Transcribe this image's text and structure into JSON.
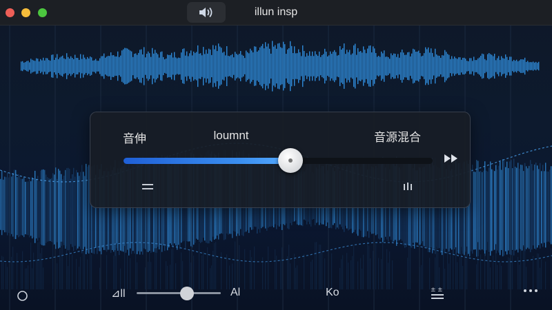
{
  "window": {
    "title": "illun insp"
  },
  "titlebar": {
    "speaker_icon": "speaker-icon"
  },
  "panel": {
    "label_left": "音伸",
    "label_center": "loumnt",
    "label_right": "音源混合",
    "slider_value": 0.54,
    "fast_forward_icon": "fast-forward-icon",
    "equal_icon": "equals-icon",
    "bars_icon": "bars-icon"
  },
  "bottom_bar": {
    "circle_icon": "circle-icon",
    "left_label": "⊿ll",
    "right_label": "Al",
    "volume_value": 0.6,
    "ko_label": "Ko",
    "mixer_icon": "mixer-icon",
    "more_icon": "more-icon"
  },
  "colors": {
    "accent": "#3b8ff0",
    "waveform": "#2f8ad8",
    "waveform_dark": "#17406e"
  }
}
